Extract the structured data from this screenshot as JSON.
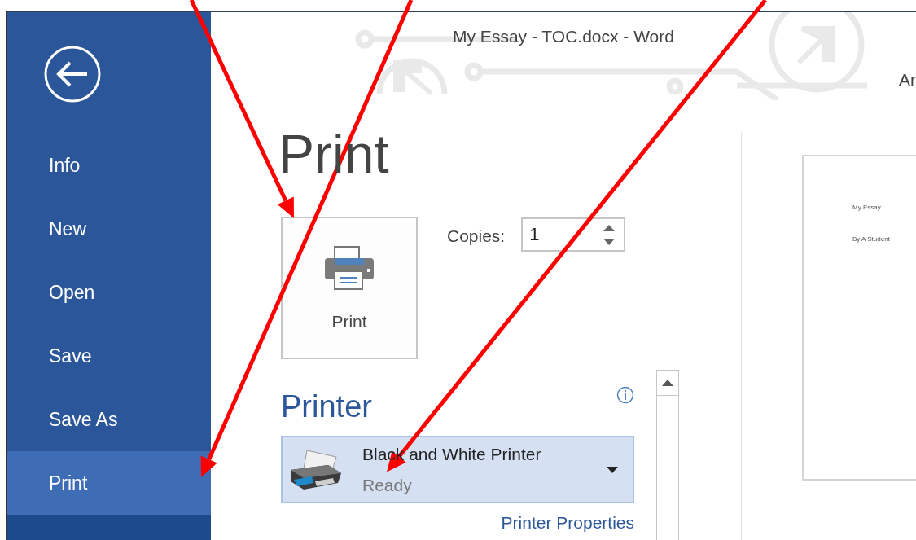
{
  "window": {
    "title": "My Essay - TOC.docx - Word",
    "account": "Ar"
  },
  "sidebar": {
    "items": [
      {
        "label": "Info",
        "selected": false
      },
      {
        "label": "New",
        "selected": false
      },
      {
        "label": "Open",
        "selected": false
      },
      {
        "label": "Save",
        "selected": false
      },
      {
        "label": "Save As",
        "selected": false
      },
      {
        "label": "Print",
        "selected": true
      }
    ]
  },
  "heading": "Print",
  "print_button": {
    "label": "Print"
  },
  "copies": {
    "label": "Copies:",
    "value": "1"
  },
  "printer": {
    "heading": "Printer",
    "name": "Black and White Printer",
    "status": "Ready",
    "properties_link": "Printer Properties"
  },
  "preview": {
    "lines": [
      "My Essay",
      "By A Student"
    ]
  },
  "annotation_arrows": [
    {
      "kind": "arrow"
    },
    {
      "kind": "arrow"
    },
    {
      "kind": "arrow"
    }
  ]
}
